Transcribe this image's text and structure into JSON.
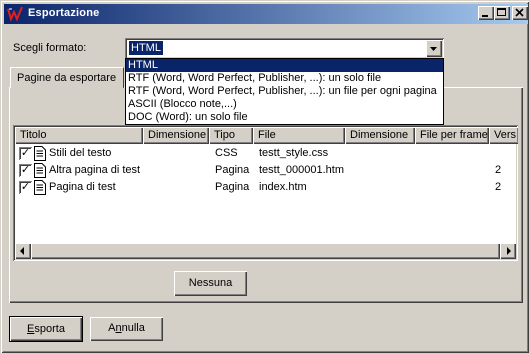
{
  "window": {
    "title": "Esportazione"
  },
  "format": {
    "label": "Scegli formato:",
    "selected": "HTML",
    "options": [
      "HTML",
      "RTF (Word, Word Perfect, Publisher, ...): un solo file",
      "RTF (Word, Word Perfect, Publisher, ...): un file per ogni pagina",
      "ASCII (Blocco note,...)",
      "DOC (Word): un solo file"
    ]
  },
  "tabs": [
    {
      "label": "Pagine da esportare"
    }
  ],
  "table": {
    "columns": [
      "Titolo",
      "Dimensione",
      "Tipo",
      "File",
      "Dimensione",
      "File per frame",
      "Vers"
    ],
    "rows": [
      {
        "checked": true,
        "title": "Stili del testo",
        "size": "",
        "type": "CSS",
        "file": "testt_style.css",
        "file_size": "",
        "frame_file": "",
        "version": ""
      },
      {
        "checked": true,
        "title": "Altra pagina di test",
        "size": "",
        "type": "Pagina",
        "file": "testt_000001.htm",
        "file_size": "",
        "frame_file": "",
        "version": "2"
      },
      {
        "checked": true,
        "title": "Pagina di test",
        "size": "",
        "type": "Pagina",
        "file": "index.htm",
        "file_size": "",
        "frame_file": "",
        "version": "2"
      }
    ]
  },
  "buttons": {
    "none": "Nessuna",
    "export_key": "E",
    "export_rest": "sporta",
    "cancel_pre": "A",
    "cancel_key": "n",
    "cancel_rest": "nulla"
  },
  "colors": {
    "titlebar_start": "#0a246a",
    "titlebar_end": "#a6caf0",
    "selection": "#0a246a",
    "face": "#d4d0c8"
  }
}
